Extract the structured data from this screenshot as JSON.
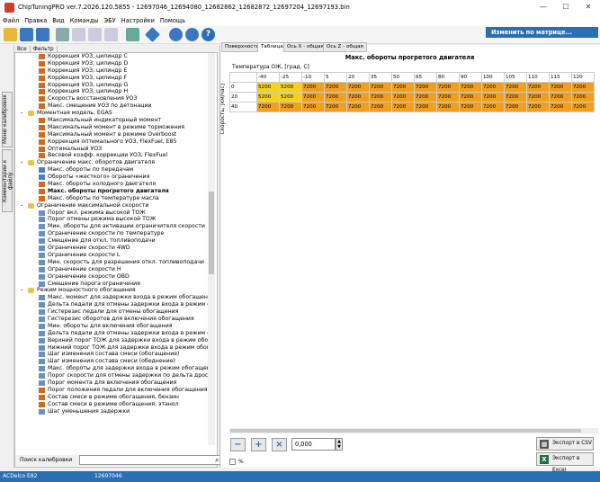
{
  "window": {
    "title": "ChipTuningPRO ver.7.2026.120.5855 - 12697046_12694080_12682862_12682872_12697204_12697193.bin"
  },
  "menu": [
    "Файл",
    "Правка",
    "Вид",
    "Команды",
    "ЭБУ",
    "Настройки",
    "Помощь"
  ],
  "toolbar": {
    "matrix_button": "Изменить по матрице..."
  },
  "left_tabs": [
    "Меню калибровок",
    "Комментарии к файлу"
  ],
  "tree_tabs": [
    "Все",
    "Фильтр"
  ],
  "tree": [
    {
      "d": 3,
      "i": "chart",
      "t": "Коррекция УОЗ, цилиндр C"
    },
    {
      "d": 3,
      "i": "chart",
      "t": "Коррекция УОЗ, цилиндр D"
    },
    {
      "d": 3,
      "i": "chart",
      "t": "Коррекция УОЗ, цилиндр E"
    },
    {
      "d": 3,
      "i": "chart",
      "t": "Коррекция УОЗ, цилиндр F"
    },
    {
      "d": 3,
      "i": "chart",
      "t": "Коррекция УОЗ, цилиндр G"
    },
    {
      "d": 3,
      "i": "chart",
      "t": "Коррекция УОЗ, цилиндр H"
    },
    {
      "d": 3,
      "i": "chart",
      "t": "Скорость восстановления УОЗ"
    },
    {
      "d": 3,
      "i": "chart",
      "t": "Макс. смещение УОЗ по детонации"
    },
    {
      "d": 2,
      "i": "folder",
      "t": "Моментная модель, EGAS"
    },
    {
      "d": 3,
      "i": "chart",
      "t": "Максимальный индикаторный момент"
    },
    {
      "d": 3,
      "i": "chart",
      "t": "Максимальный момент в режиме торможения"
    },
    {
      "d": 3,
      "i": "chart",
      "t": "Максимальный момент в режиме Overboost"
    },
    {
      "d": 3,
      "i": "chart",
      "t": "Коррекция оптимального УОЗ, FlexFuel, E85"
    },
    {
      "d": 3,
      "i": "chart",
      "t": "Оптимальный УОЗ"
    },
    {
      "d": 3,
      "i": "chart",
      "t": "Весовой коэфф. коррекции УОЗ, FlexFuel"
    },
    {
      "d": 2,
      "i": "folder",
      "t": "Ограничение макс. оборотов двигателя"
    },
    {
      "d": 3,
      "i": "line",
      "t": "Макс. обороты по передачам"
    },
    {
      "d": 3,
      "i": "line",
      "t": "Обороты «жесткого» ограничения"
    },
    {
      "d": 3,
      "i": "chart",
      "t": "Макс. обороты холодного двигателя"
    },
    {
      "d": 3,
      "i": "chart",
      "t": "Макс. обороты прогретого двигателя",
      "sel": true
    },
    {
      "d": 3,
      "i": "chart",
      "t": "Макс. обороты по температуре масла"
    },
    {
      "d": 2,
      "i": "folder",
      "t": "Ограничение максимальной скорости"
    },
    {
      "d": 3,
      "i": "table",
      "t": "Порог вкл. режима высокой ТОЖ"
    },
    {
      "d": 3,
      "i": "table",
      "t": "Порог отмены режима высокой ТОЖ"
    },
    {
      "d": 3,
      "i": "table",
      "t": "Мин. обороты для активации ограничителя скорости"
    },
    {
      "d": 3,
      "i": "table",
      "t": "Ограничение скорости по температуре"
    },
    {
      "d": 3,
      "i": "table",
      "t": "Смещение для откл. топливоподачи"
    },
    {
      "d": 3,
      "i": "table",
      "t": "Ограничение скорости 4WD"
    },
    {
      "d": 3,
      "i": "table",
      "t": "Ограничение скорости L"
    },
    {
      "d": 3,
      "i": "table",
      "t": "Мин. скорость для разрешения откл. топливоподачи"
    },
    {
      "d": 3,
      "i": "table",
      "t": "Ограничение скорости H"
    },
    {
      "d": 3,
      "i": "table",
      "t": "Ограничение скорости OBD"
    },
    {
      "d": 3,
      "i": "table",
      "t": "Смещение порога ограничения"
    },
    {
      "d": 2,
      "i": "folder",
      "t": "Режим мощностного обогащения"
    },
    {
      "d": 3,
      "i": "table",
      "t": "Макс. момент для задержки входа в режим обогащения"
    },
    {
      "d": 3,
      "i": "table",
      "t": "Дельта педали для отмены задержки входа в режим об"
    },
    {
      "d": 3,
      "i": "table",
      "t": "Гистерезис педали для отмены обогащения"
    },
    {
      "d": 3,
      "i": "table",
      "t": "Гистерезис оборотов для включения обогащения"
    },
    {
      "d": 3,
      "i": "table",
      "t": "Мин. обороты для включения обогащения"
    },
    {
      "d": 3,
      "i": "table",
      "t": "Дельта педали для отмены задержки входа в режим об"
    },
    {
      "d": 3,
      "i": "table",
      "t": "Верхний порог ТОЖ для задержки входа в режим обог"
    },
    {
      "d": 3,
      "i": "table",
      "t": "Нижний порог ТОЖ для задержки входа в режим обог"
    },
    {
      "d": 3,
      "i": "table",
      "t": "Шаг изменения состава смеси (обогащение)"
    },
    {
      "d": 3,
      "i": "table",
      "t": "Шаг изменения состава смеси (обеднение)"
    },
    {
      "d": 3,
      "i": "table",
      "t": "Макс. обороты для задержки входа в режим обогащения"
    },
    {
      "d": 3,
      "i": "table",
      "t": "Порог скорости для отмены задержки по дельта дросс"
    },
    {
      "d": 3,
      "i": "table",
      "t": "Порог момента для включения обогащения"
    },
    {
      "d": 3,
      "i": "chart",
      "t": "Порог положения педали для включения обогащения"
    },
    {
      "d": 3,
      "i": "chart",
      "t": "Состав смеси в режиме обогащения, бензин"
    },
    {
      "d": 3,
      "i": "chart",
      "t": "Состав смеси в режиме обогащения, этанол"
    },
    {
      "d": 3,
      "i": "table",
      "t": "Шаг уменьшения задержки"
    }
  ],
  "search": {
    "label": "Поиск калибровки"
  },
  "right_tabs": [
    "Поверхность",
    "Таблица",
    "Ось X - общая",
    "Ось Z - общая"
  ],
  "table": {
    "title": "Макс. обороты прогретого двигателя",
    "x_label": "Температура ОЖ, [град. C]",
    "y_label": "Скорость, [км/час]",
    "x_headers": [
      "-40",
      "-25",
      "-10",
      "5",
      "20",
      "35",
      "50",
      "65",
      "80",
      "90",
      "100",
      "105",
      "110",
      "115",
      "120"
    ],
    "rows": [
      {
        "y": "0",
        "v": [
          "5200",
          "5200",
          "7200",
          "7200",
          "7200",
          "7200",
          "7200",
          "7200",
          "7200",
          "7200",
          "7200",
          "7200",
          "7200",
          "7200",
          "7200"
        ]
      },
      {
        "y": "20",
        "v": [
          "5200",
          "5200",
          "7200",
          "7200",
          "7200",
          "7200",
          "7200",
          "7200",
          "7200",
          "7200",
          "7200",
          "7200",
          "7200",
          "7200",
          "7200"
        ]
      },
      {
        "y": "40",
        "v": [
          "7200",
          "7200",
          "7200",
          "7200",
          "7200",
          "7200",
          "7200",
          "7200",
          "7200",
          "7200",
          "7200",
          "7200",
          "7200",
          "7200",
          "7200"
        ]
      }
    ]
  },
  "controls": {
    "value": "0,000",
    "percent_label": "%",
    "export_csv": "Экспорт в CSV",
    "export_excel": "Экспорт в Excel"
  },
  "status": {
    "left": "ACDelco E82",
    "mid": "12697046"
  },
  "colors": {
    "accent": "#2a6fb3",
    "cell_orange": "#f0a01e",
    "cell_yellow": "#f5d21e"
  }
}
